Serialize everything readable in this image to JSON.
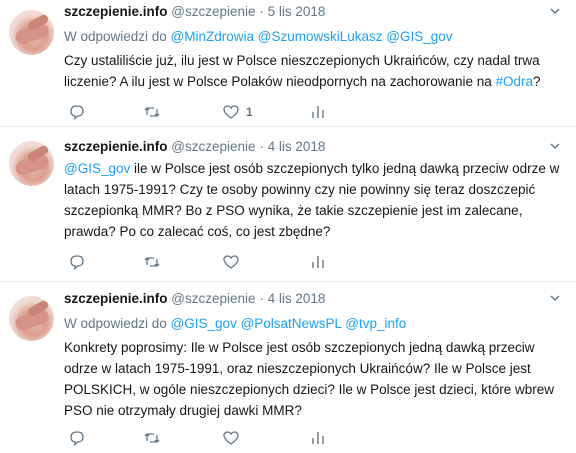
{
  "tweets": [
    {
      "name": "szczepienie.info",
      "handle": "@szczepienie",
      "date": "5 lis 2018",
      "reply_prefix": "W odpowiedzi do",
      "reply_to": "@MinZdrowia @SzumowskiLukasz @GIS_gov",
      "text_before": "Czy ustaliliście już, ilu jest w Polsce nieszczepionych Ukraińców, czy nadal trwa liczenie? A ilu jest w Polsce Polaków nieodpornych na zachorowanie na ",
      "text_link": "#Odra",
      "text_after": "?",
      "like_count": "1"
    },
    {
      "name": "szczepienie.info",
      "handle": "@szczepienie",
      "date": "4 lis 2018",
      "text_link": "@GIS_gov",
      "text_after": "  ile w Polsce jest osób szczepionych tylko jedną dawką przeciw odrze w latach 1975-1991? Czy te osoby powinny czy nie powinny się teraz doszczepić szczepionką MMR? Bo z PSO wynika, że takie szczepienie jest im zalecane, prawda? Po co zalecać coś, co jest zbędne?"
    },
    {
      "name": "szczepienie.info",
      "handle": "@szczepienie",
      "date": "4 lis 2018",
      "reply_prefix": "W odpowiedzi do",
      "reply_to": "@GIS_gov @PolsatNewsPL @tvp_info",
      "text": "Konkrety poprosimy: Ile w Polsce jest osób szczepionych jedną dawką przeciw odrze w latach 1975-1991, oraz nieszczepionych Ukraińców? Ile w Polsce jest POLSKICH, w ogóle nieszczepionych dzieci? Ile w Polsce jest dzieci, które wbrew PSO nie otrzymały drugiej dawki MMR?"
    }
  ],
  "separator": "·",
  "colors": {
    "link": "#1da1f2",
    "muted": "#657786",
    "text": "#14171a",
    "border": "#e6ecf0"
  },
  "icons": [
    "chevron-down-icon",
    "reply-icon",
    "retweet-icon",
    "like-icon",
    "analytics-icon"
  ]
}
